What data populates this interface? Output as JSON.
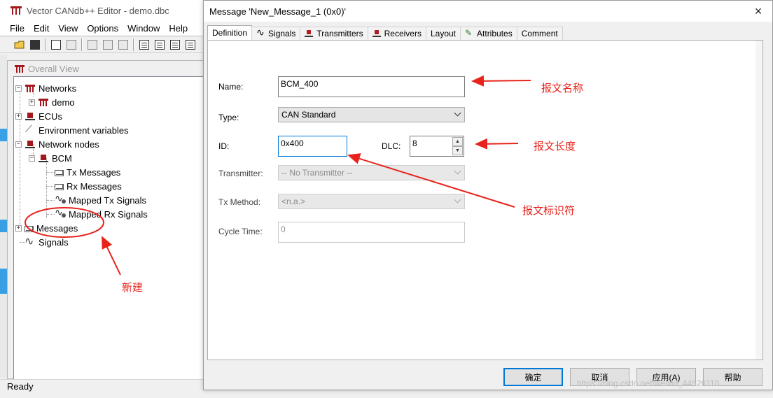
{
  "main_window": {
    "title": "Vector CANdb++ Editor - demo.dbc",
    "menu": [
      "File",
      "Edit",
      "View",
      "Options",
      "Window",
      "Help"
    ]
  },
  "overall_view": {
    "title": "Overall View",
    "tree": [
      {
        "label": "Networks"
      },
      {
        "label": "demo"
      },
      {
        "label": "ECUs"
      },
      {
        "label": "Environment variables"
      },
      {
        "label": "Network nodes"
      },
      {
        "label": "BCM"
      },
      {
        "label": "Tx Messages"
      },
      {
        "label": "Rx Messages"
      },
      {
        "label": "Mapped Tx Signals"
      },
      {
        "label": "Mapped Rx Signals"
      },
      {
        "label": "Messages"
      },
      {
        "label": "Signals"
      }
    ]
  },
  "status_bar": {
    "text": "Ready"
  },
  "dialog": {
    "title": "Message 'New_Message_1 (0x0)'",
    "close_symbol": "×",
    "tabs": [
      "Definition",
      "Signals",
      "Transmitters",
      "Receivers",
      "Layout",
      "Attributes",
      "Comment"
    ],
    "active_tab": "Definition",
    "fields": {
      "name_label": "Name:",
      "name_value": "BCM_400",
      "type_label": "Type:",
      "type_value": "CAN Standard",
      "id_label": "ID:",
      "id_value": "0x400",
      "dlc_label": "DLC:",
      "dlc_value": "8",
      "transmitter_label": "Transmitter:",
      "transmitter_value": "-- No Transmitter --",
      "tx_method_label": "Tx Method:",
      "tx_method_value": "<n.a.>",
      "cycle_time_label": "Cycle Time:",
      "cycle_time_value": "0"
    },
    "buttons": {
      "ok": "确定",
      "cancel": "取消",
      "apply": "应用(A)",
      "help": "帮助"
    }
  },
  "annotations": {
    "name": "报文名称",
    "length": "报文长度",
    "id": "报文标识符",
    "new": "新建"
  },
  "watermark": "https://blog.csdn.net/weixin_44526110",
  "colors": {
    "annotation": "#e8231b",
    "accent": "#0078d7",
    "tree_icon": "#a3161c"
  }
}
